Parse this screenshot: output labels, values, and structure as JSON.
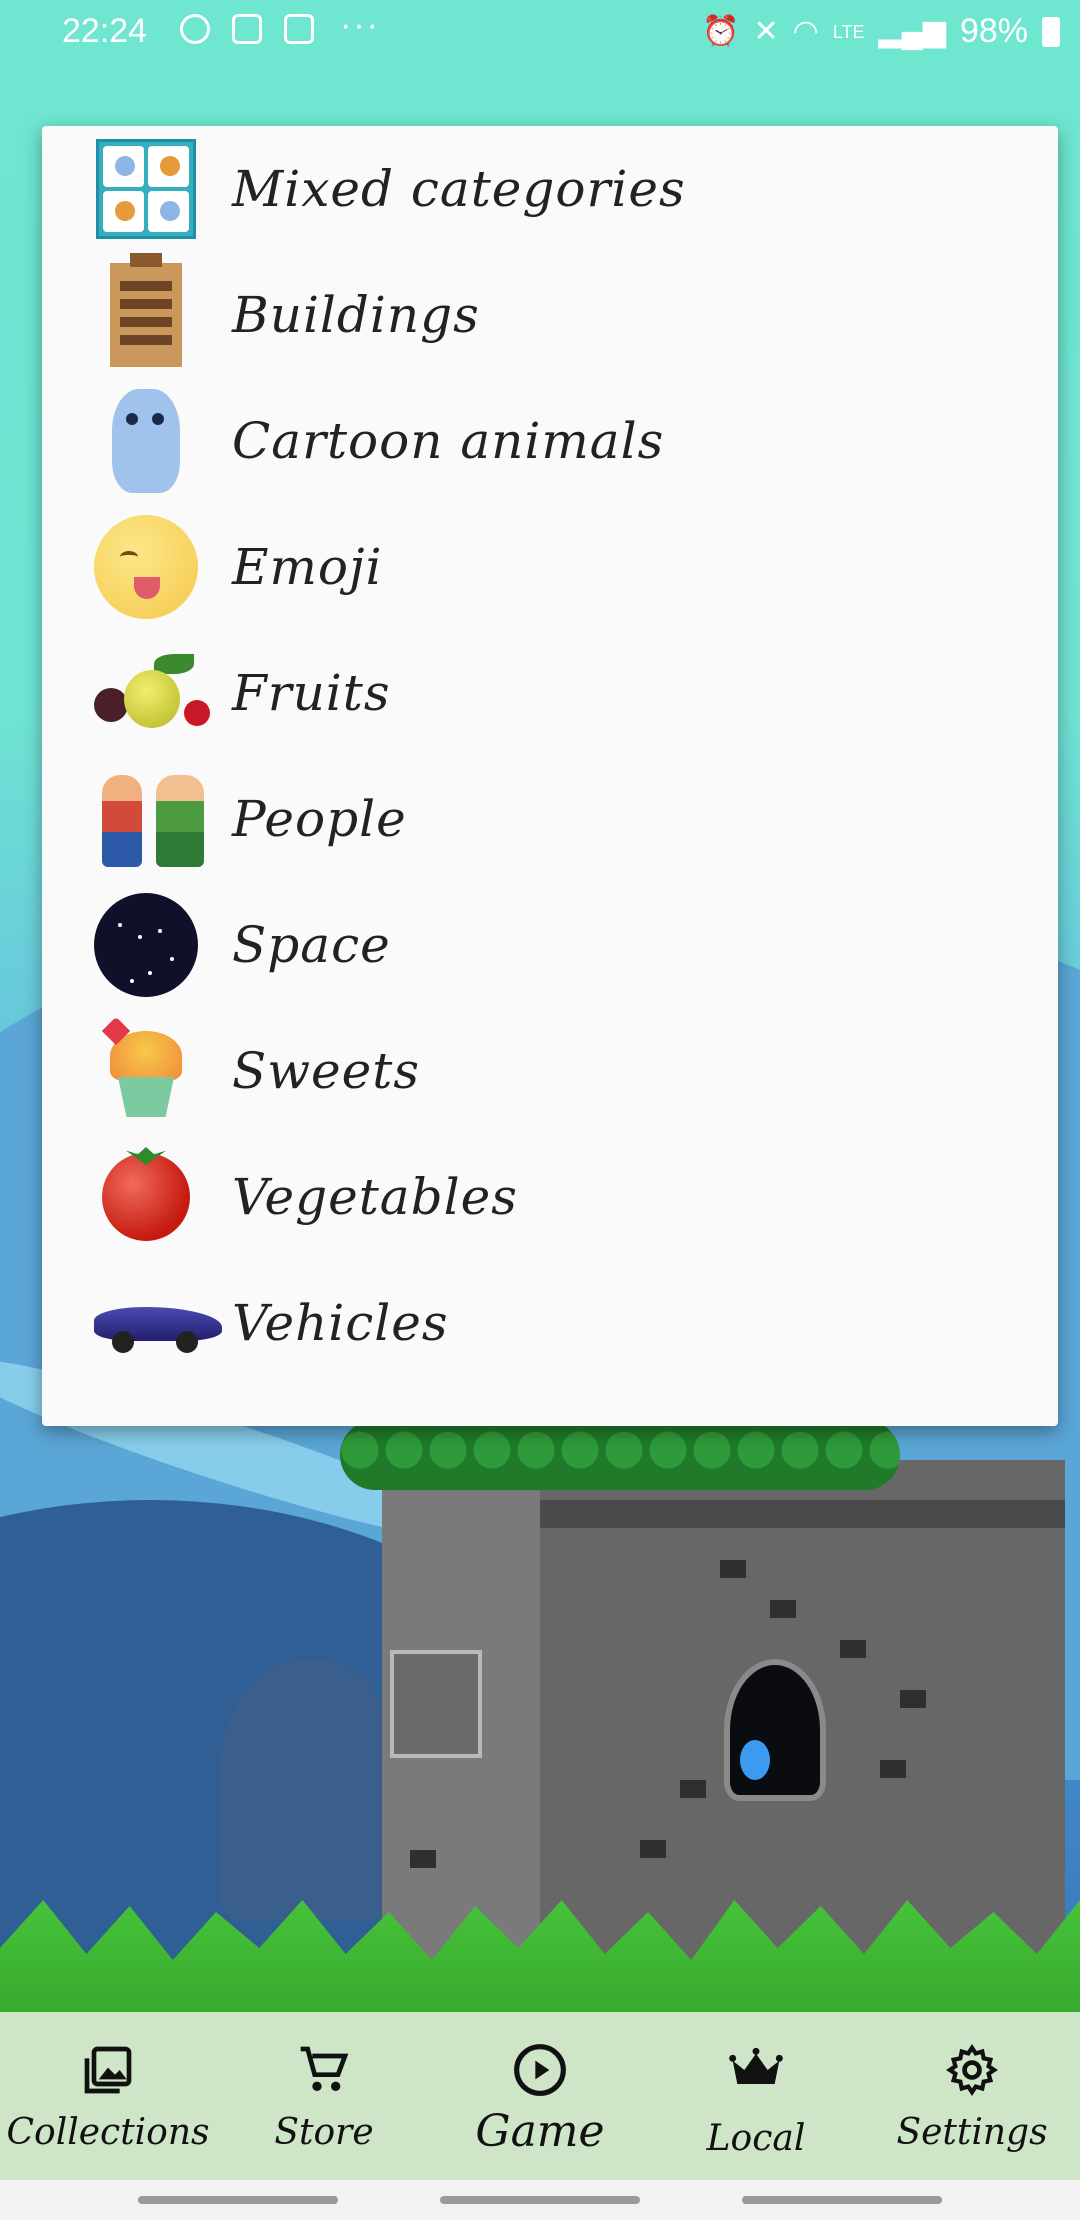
{
  "status_bar": {
    "time": "22:24",
    "overflow": "···",
    "lte": "LTE",
    "battery": "98%"
  },
  "categories": [
    {
      "label": "Mixed categories",
      "icon": "mixed-categories-icon"
    },
    {
      "label": "Buildings",
      "icon": "building-icon"
    },
    {
      "label": "Cartoon animals",
      "icon": "cartoon-cat-icon"
    },
    {
      "label": "Emoji",
      "icon": "emoji-icon"
    },
    {
      "label": "Fruits",
      "icon": "fruits-icon"
    },
    {
      "label": "People",
      "icon": "people-icon"
    },
    {
      "label": "Space",
      "icon": "constellation-icon"
    },
    {
      "label": "Sweets",
      "icon": "cupcake-icon"
    },
    {
      "label": "Vegetables",
      "icon": "tomato-icon"
    },
    {
      "label": "Vehicles",
      "icon": "car-icon"
    }
  ],
  "bottom_nav": {
    "collections": "Collections",
    "store": "Store",
    "game": "Game",
    "local": "Local",
    "settings": "Settings"
  },
  "colors": {
    "sky": "#6ee6d0",
    "nav_bg": "#cfe5c8",
    "popup_bg": "#fafafa"
  }
}
